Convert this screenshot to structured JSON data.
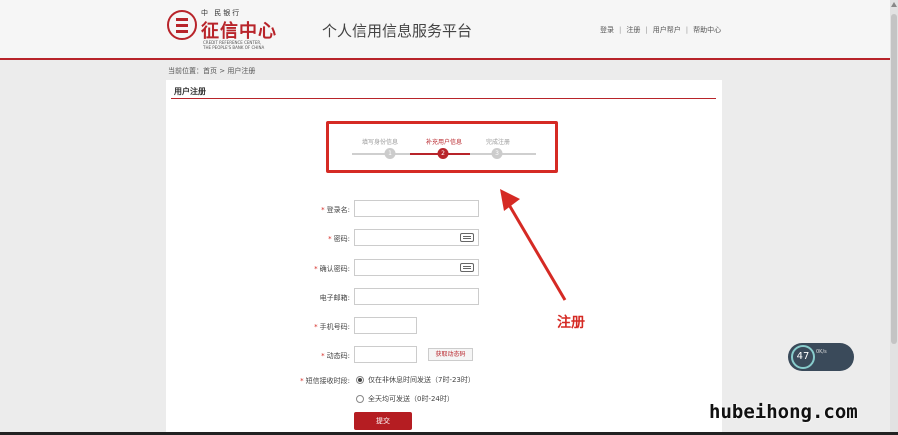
{
  "header": {
    "logo_top": "中  民银行",
    "logo_main": "征信中心",
    "logo_en_line1": "CREDIT REFERENCE CENTER,",
    "logo_en_line2": "THE PEOPLE'S BANK OF CHINA",
    "site_title": "个人信用信息服务平台",
    "nav": [
      "登录",
      "注册",
      "用户帮户",
      "帮助中心"
    ],
    "nav_separator": "|"
  },
  "breadcrumb": "当前位置：首页 > 用户注册",
  "panel": {
    "title": "用户注册"
  },
  "steps": {
    "items": [
      {
        "label": "填写身份信息",
        "number": "1"
      },
      {
        "label": "补充用户信息",
        "number": "2"
      },
      {
        "label": "完成注册",
        "number": "3"
      }
    ],
    "active_index": 1
  },
  "form": {
    "required_mark": "*",
    "fields": [
      {
        "label": "登录名:",
        "required": true,
        "value": ""
      },
      {
        "label": "密码:",
        "required": true,
        "value": ""
      },
      {
        "label": "确认密码:",
        "required": true,
        "value": ""
      },
      {
        "label": "电子邮箱:",
        "required": false,
        "value": ""
      },
      {
        "label": "手机号码:",
        "required": true,
        "value": ""
      },
      {
        "label": "动态码:",
        "required": true,
        "value": ""
      }
    ],
    "get_code_button": "获取动态码",
    "sms_time_label": "短信接收时段:",
    "sms_options": [
      {
        "label": "仅在非休息时间发送（7时-23时）",
        "checked": true
      },
      {
        "label": "全天均可发送（0时-24时）",
        "checked": false
      }
    ],
    "submit_label": "提交"
  },
  "annotation": "注册",
  "widget": {
    "number": "47",
    "sub": "0K/s"
  },
  "watermark": "hubeihong.com",
  "colors": {
    "brand_red": "#b8242a",
    "annotation_red": "#d52a24"
  }
}
